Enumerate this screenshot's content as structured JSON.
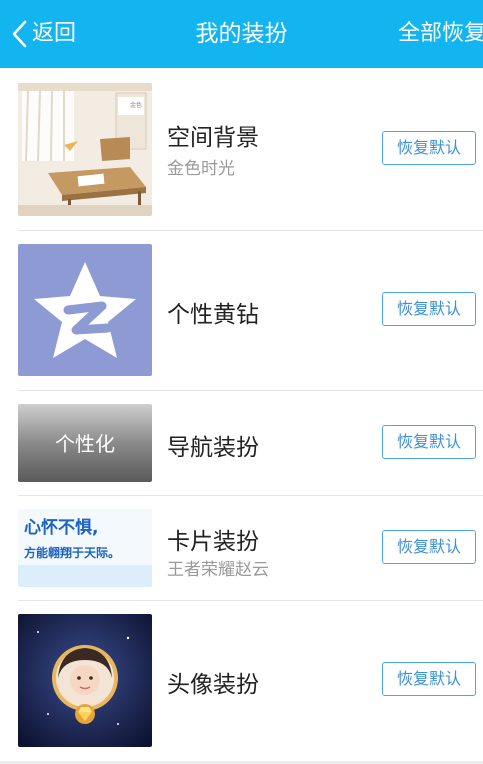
{
  "header": {
    "back_label": "返回",
    "title": "我的装扮",
    "restore_all_label": "全部恢复"
  },
  "items": [
    {
      "name": "空间背景",
      "subtitle": "金色时光",
      "button": "恢复默认",
      "thumb_icon": "classroom-scene-thumbnail"
    },
    {
      "name": "个性黄钻",
      "subtitle": "",
      "button": "恢复默认",
      "thumb_icon": "qzone-star-thumbnail"
    },
    {
      "name": "导航装扮",
      "subtitle": "",
      "button": "恢复默认",
      "thumb_icon": "gray-nav-thumbnail",
      "thumb_text": "个性化"
    },
    {
      "name": "卡片装扮",
      "subtitle": "王者荣耀赵云",
      "button": "恢复默认",
      "thumb_icon": "slogan-card-thumbnail",
      "thumb_text_line1": "心怀不惧,",
      "thumb_text_line2": "方能翱翔于天际。"
    },
    {
      "name": "头像装扮",
      "subtitle": "",
      "button": "恢复默认",
      "thumb_icon": "avatar-frame-thumbnail"
    }
  ],
  "colors": {
    "header_bg": "#13b5f0",
    "button_border": "#4ba7ea",
    "button_text": "#3d8fd8"
  }
}
